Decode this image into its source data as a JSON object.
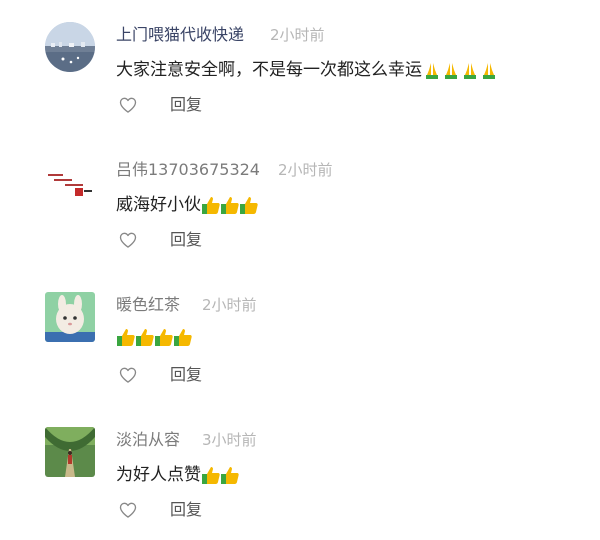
{
  "comments": [
    {
      "username": "上门喂猫代收快递",
      "time": "2小时前",
      "text": "大家注意安全啊，不是每一次都这么幸运",
      "emoji": [
        "folded-hands",
        "folded-hands",
        "folded-hands",
        "folded-hands"
      ],
      "reply_label": "回复"
    },
    {
      "username": "吕伟13703675324",
      "time": "2小时前",
      "text": "威海好小伙",
      "emoji": [
        "thumbs-up",
        "thumbs-up",
        "thumbs-up"
      ],
      "reply_label": "回复"
    },
    {
      "username": "暖色红茶",
      "time": "2小时前",
      "text": "",
      "emoji": [
        "thumbs-up",
        "thumbs-up",
        "thumbs-up",
        "thumbs-up"
      ],
      "reply_label": "回复"
    },
    {
      "username": "淡泊从容",
      "time": "3小时前",
      "text": "为好人点赞",
      "emoji": [
        "thumbs-up",
        "thumbs-up"
      ],
      "reply_label": "回复"
    }
  ],
  "colors": {
    "highlight_name": "#3a4466",
    "name": "#7b7b7b",
    "time": "#b6b6b6",
    "content": "#222222",
    "action": "#555555",
    "emoji_green": "#3aa640",
    "emoji_yellow": "#f5b800"
  }
}
